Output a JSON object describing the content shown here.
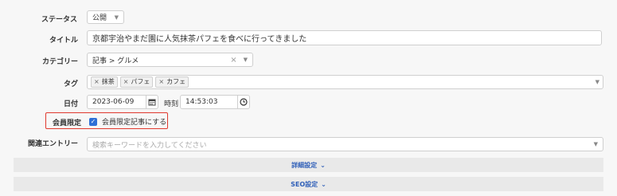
{
  "status": {
    "label": "ステータス",
    "value": "公開"
  },
  "title": {
    "label": "タイトル",
    "value": "京都宇治やまだ園に人気抹茶パフェを食べに行ってきました"
  },
  "category": {
    "label": "カテゴリー",
    "value": "記事 > グルメ"
  },
  "tags": {
    "label": "タグ",
    "items": [
      "抹茶",
      "パフェ",
      "カフェ"
    ]
  },
  "date": {
    "label": "日付",
    "value": "2023-06-09",
    "time_label": "時刻",
    "time_value": "14:53:03"
  },
  "members": {
    "label": "会員限定",
    "checkbox_label": "会員限定記事にする",
    "checked": true
  },
  "related": {
    "label": "関連エントリー",
    "placeholder": "検索キーワードを入力してください"
  },
  "sections": {
    "detail": "詳細設定",
    "seo": "SEO設定"
  },
  "colors": {
    "accent": "#2f6fd6",
    "highlight": "#e0392e",
    "link": "#2f5fb8"
  }
}
